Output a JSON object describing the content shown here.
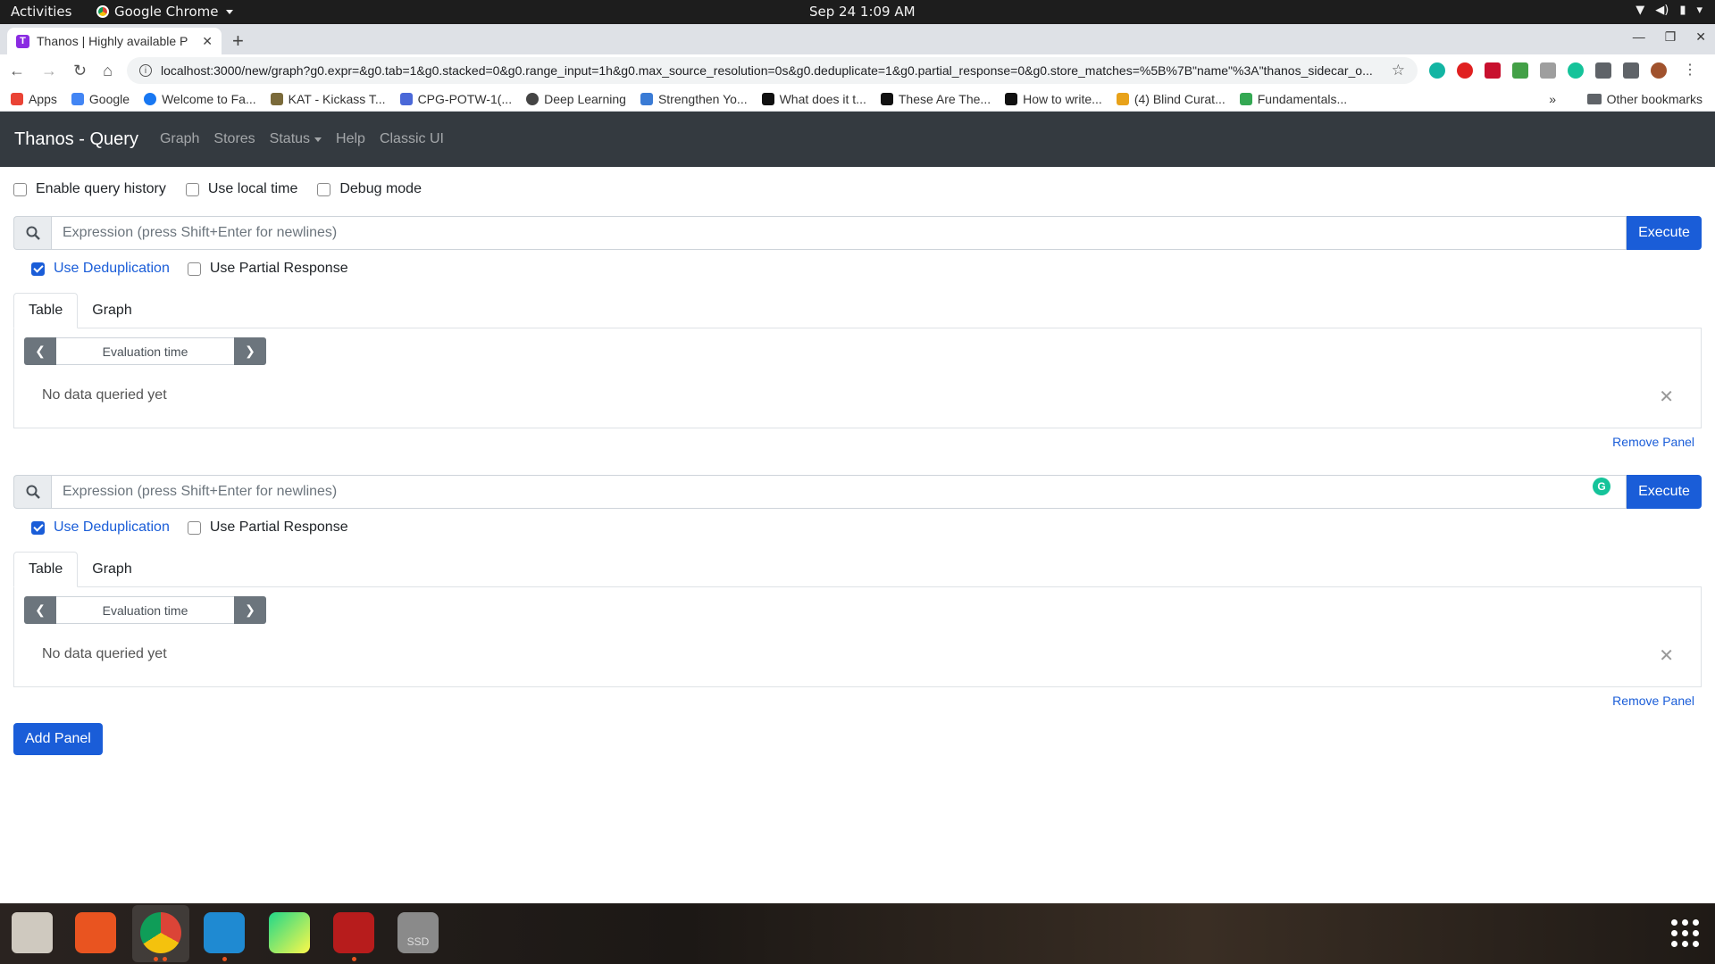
{
  "system": {
    "activities": "Activities",
    "app_name": "Google Chrome",
    "clock": "Sep 24  1:09 AM"
  },
  "browser": {
    "tab_title": "Thanos | Highly available P",
    "tab_favicon": "T",
    "url": "localhost:3000/new/graph?g0.expr=&g0.tab=1&g0.stacked=0&g0.range_input=1h&g0.max_source_resolution=0s&g0.deduplicate=1&g0.partial_response=0&g0.store_matches=%5B%7B\"name\"%3A\"thanos_sidecar_o...",
    "bookmarks": [
      {
        "label": "Apps",
        "color": "#ea4335"
      },
      {
        "label": "Google",
        "color": "#4285f4"
      },
      {
        "label": "Welcome to Fa...",
        "color": "#1877f2"
      },
      {
        "label": "KAT - Kickass T...",
        "color": "#7a6a3a"
      },
      {
        "label": "CPG-POTW-1(...",
        "color": "#4a68d8"
      },
      {
        "label": "Deep Learning",
        "color": "#444444"
      },
      {
        "label": "Strengthen Yo...",
        "color": "#3a7bd5"
      },
      {
        "label": "What does it t...",
        "color": "#111111"
      },
      {
        "label": "These Are The...",
        "color": "#111111"
      },
      {
        "label": "How to write...",
        "color": "#111111"
      },
      {
        "label": "(4) Blind Curat...",
        "color": "#e8a21a"
      },
      {
        "label": "Fundamentals...",
        "color": "#34a853"
      }
    ],
    "more_bookmarks": "»",
    "other_bookmarks": "Other bookmarks"
  },
  "navbar": {
    "brand": "Thanos - Query",
    "links": [
      "Graph",
      "Stores",
      "Status",
      "Help",
      "Classic UI"
    ]
  },
  "options": {
    "query_history": "Enable query history",
    "local_time": "Use local time",
    "debug_mode": "Debug mode"
  },
  "panels": [
    {
      "placeholder": "Expression (press Shift+Enter for newlines)",
      "execute": "Execute",
      "dedup_label": "Use Deduplication",
      "dedup_checked": true,
      "partial_label": "Use Partial Response",
      "partial_checked": false,
      "tabs": [
        "Table",
        "Graph"
      ],
      "active_tab": "Table",
      "eval_time": "Evaluation time",
      "no_data": "No data queried yet",
      "remove": "Remove Panel"
    },
    {
      "placeholder": "Expression (press Shift+Enter for newlines)",
      "execute": "Execute",
      "dedup_label": "Use Deduplication",
      "dedup_checked": true,
      "partial_label": "Use Partial Response",
      "partial_checked": false,
      "tabs": [
        "Table",
        "Graph"
      ],
      "active_tab": "Table",
      "eval_time": "Evaluation time",
      "no_data": "No data queried yet",
      "remove": "Remove Panel"
    }
  ],
  "add_panel": "Add Panel",
  "dock": {
    "ssd_label": "SSD"
  },
  "colors": {
    "primary": "#1a5dd8",
    "navbar": "#343a40"
  }
}
